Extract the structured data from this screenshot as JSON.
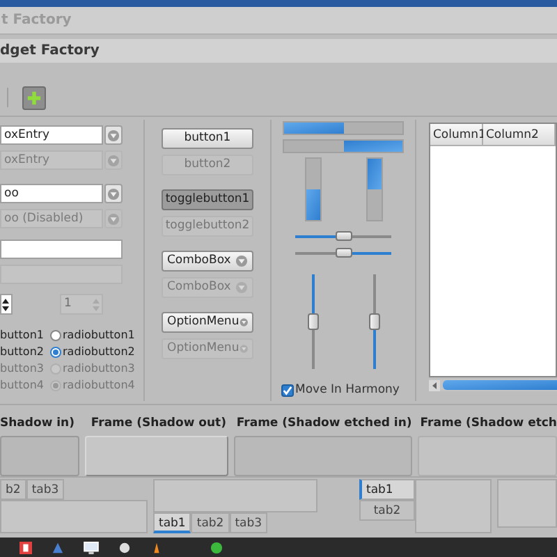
{
  "window": {
    "title": "t Factory"
  },
  "header": {
    "title": "dget Factory"
  },
  "combo_entries": [
    {
      "value": "oxEntry",
      "disabled": false
    },
    {
      "value": "oxEntry",
      "disabled": true
    }
  ],
  "combos": [
    {
      "value": "oo",
      "disabled": false
    },
    {
      "value": "oo (Disabled)",
      "disabled": true
    }
  ],
  "entries": [
    {
      "disabled": false
    },
    {
      "disabled": true
    }
  ],
  "spin_buttons": [
    {
      "disabled": false
    },
    {
      "value": "1",
      "disabled": true
    }
  ],
  "radio_labels": [
    {
      "label": "button1",
      "disabled": false
    },
    {
      "label": "button2",
      "disabled": false
    },
    {
      "label": "button3",
      "disabled": true
    },
    {
      "label": "button4",
      "disabled": true
    }
  ],
  "radio_buttons": [
    {
      "label": "radiobutton1",
      "selected": false,
      "disabled": false
    },
    {
      "label": "radiobutton2",
      "selected": true,
      "disabled": false
    },
    {
      "label": "radiobutton3",
      "selected": false,
      "disabled": true
    },
    {
      "label": "radiobutton4",
      "selected": true,
      "disabled": true
    }
  ],
  "buttons": [
    {
      "kind": "button",
      "label": "button1",
      "disabled": false
    },
    {
      "kind": "button",
      "label": "button2",
      "disabled": true
    },
    {
      "kind": "toggle",
      "label": "togglebutton1",
      "pressed": true,
      "disabled": false
    },
    {
      "kind": "toggle",
      "label": "togglebutton2",
      "pressed": false,
      "disabled": true
    },
    {
      "kind": "combo",
      "label": "ComboBox",
      "disabled": false
    },
    {
      "kind": "combo",
      "label": "ComboBox",
      "disabled": true
    },
    {
      "kind": "option",
      "label": "OptionMenu",
      "disabled": false
    },
    {
      "kind": "option",
      "label": "OptionMenu",
      "disabled": true
    }
  ],
  "progress_bars": [
    {
      "level": 0.5,
      "inverted": false
    },
    {
      "level": 0.5,
      "inverted": true
    }
  ],
  "vertical_progress_bars": [
    {
      "level": 0.5,
      "inverted": false
    },
    {
      "level": 0.5,
      "inverted": true
    }
  ],
  "scales": [
    {
      "level": 0.5,
      "inverted": false
    },
    {
      "level": 0.5,
      "inverted": true
    }
  ],
  "vertical_scales": [
    {
      "level": 0.5,
      "inverted": false
    },
    {
      "level": 0.5,
      "inverted": true
    }
  ],
  "harmony": {
    "label": "Move In Harmony",
    "checked": true
  },
  "tree": {
    "columns": [
      "Column1",
      "Column2"
    ]
  },
  "frames": [
    {
      "label": "Shadow in)",
      "kind": "in"
    },
    {
      "label": "Frame (Shadow out)",
      "kind": "out"
    },
    {
      "label": "Frame (Shadow etched in)",
      "kind": "etched_in"
    },
    {
      "label": "Frame (Shadow etch",
      "kind": "etched_out"
    }
  ],
  "notebooks": [
    {
      "kind": "top",
      "tabs": [
        {
          "label": "b2",
          "selected": false
        },
        {
          "label": "tab3",
          "selected": false
        }
      ]
    },
    {
      "kind": "bottom",
      "tabs": [
        {
          "label": "tab1",
          "selected": true
        },
        {
          "label": "tab2",
          "selected": false
        },
        {
          "label": "tab3",
          "selected": false
        }
      ]
    },
    {
      "kind": "left",
      "tabs": [
        {
          "label": "tab1",
          "selected": true
        },
        {
          "label": "tab2",
          "selected": false
        }
      ]
    }
  ]
}
